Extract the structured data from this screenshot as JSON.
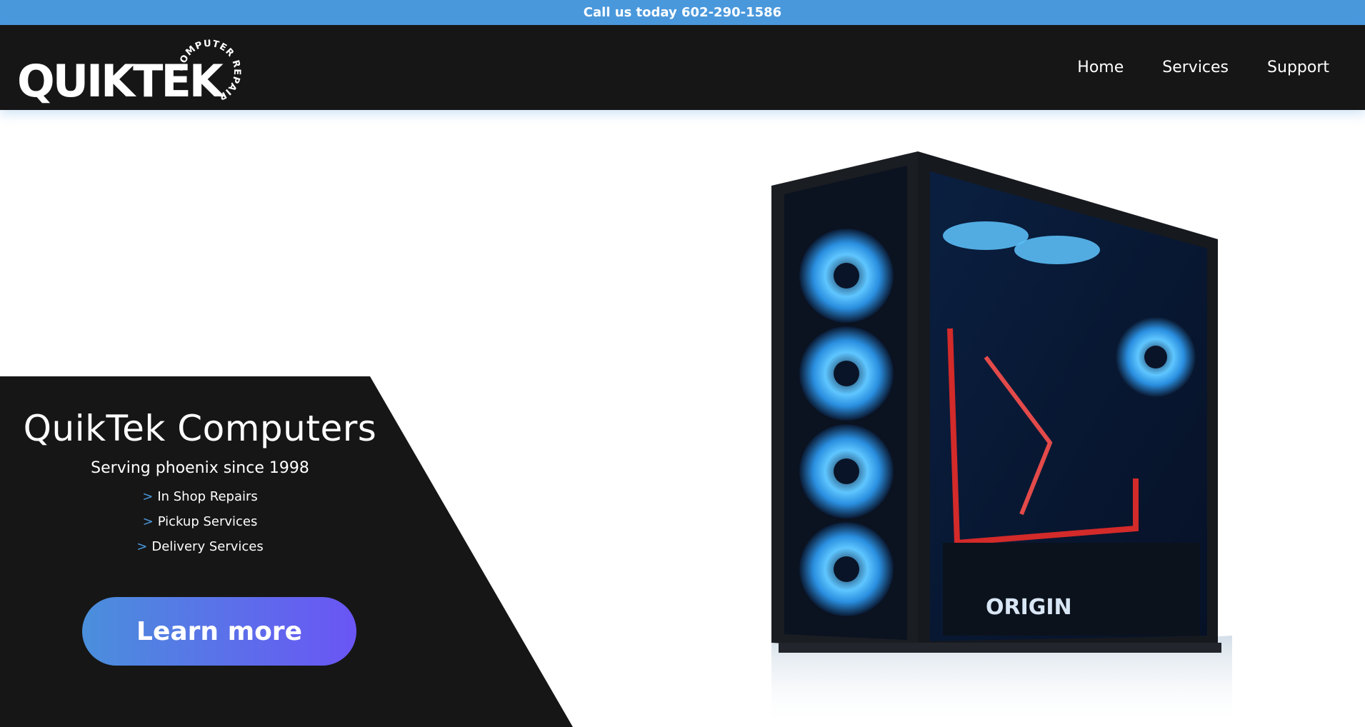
{
  "topbar": {
    "text": "Call us today 602-290-1586"
  },
  "logo": {
    "word": "QUIKTEK",
    "ring_text": "COMPUTER REPAIR"
  },
  "nav": {
    "items": [
      "Home",
      "Services",
      "Support"
    ]
  },
  "hero": {
    "title": "QuikTek Computers",
    "subtitle": "Serving phoenix since 1998",
    "bullet": ">",
    "list": [
      "In Shop Repairs",
      "Pickup Services",
      "Delivery Services"
    ],
    "cta": "Learn more"
  },
  "image": {
    "brand_mark": "ORIGIN"
  },
  "colors": {
    "accent": "#4a98dc",
    "dark": "#161616",
    "cta_start": "#4a8fdc",
    "cta_end": "#6a55f5"
  }
}
